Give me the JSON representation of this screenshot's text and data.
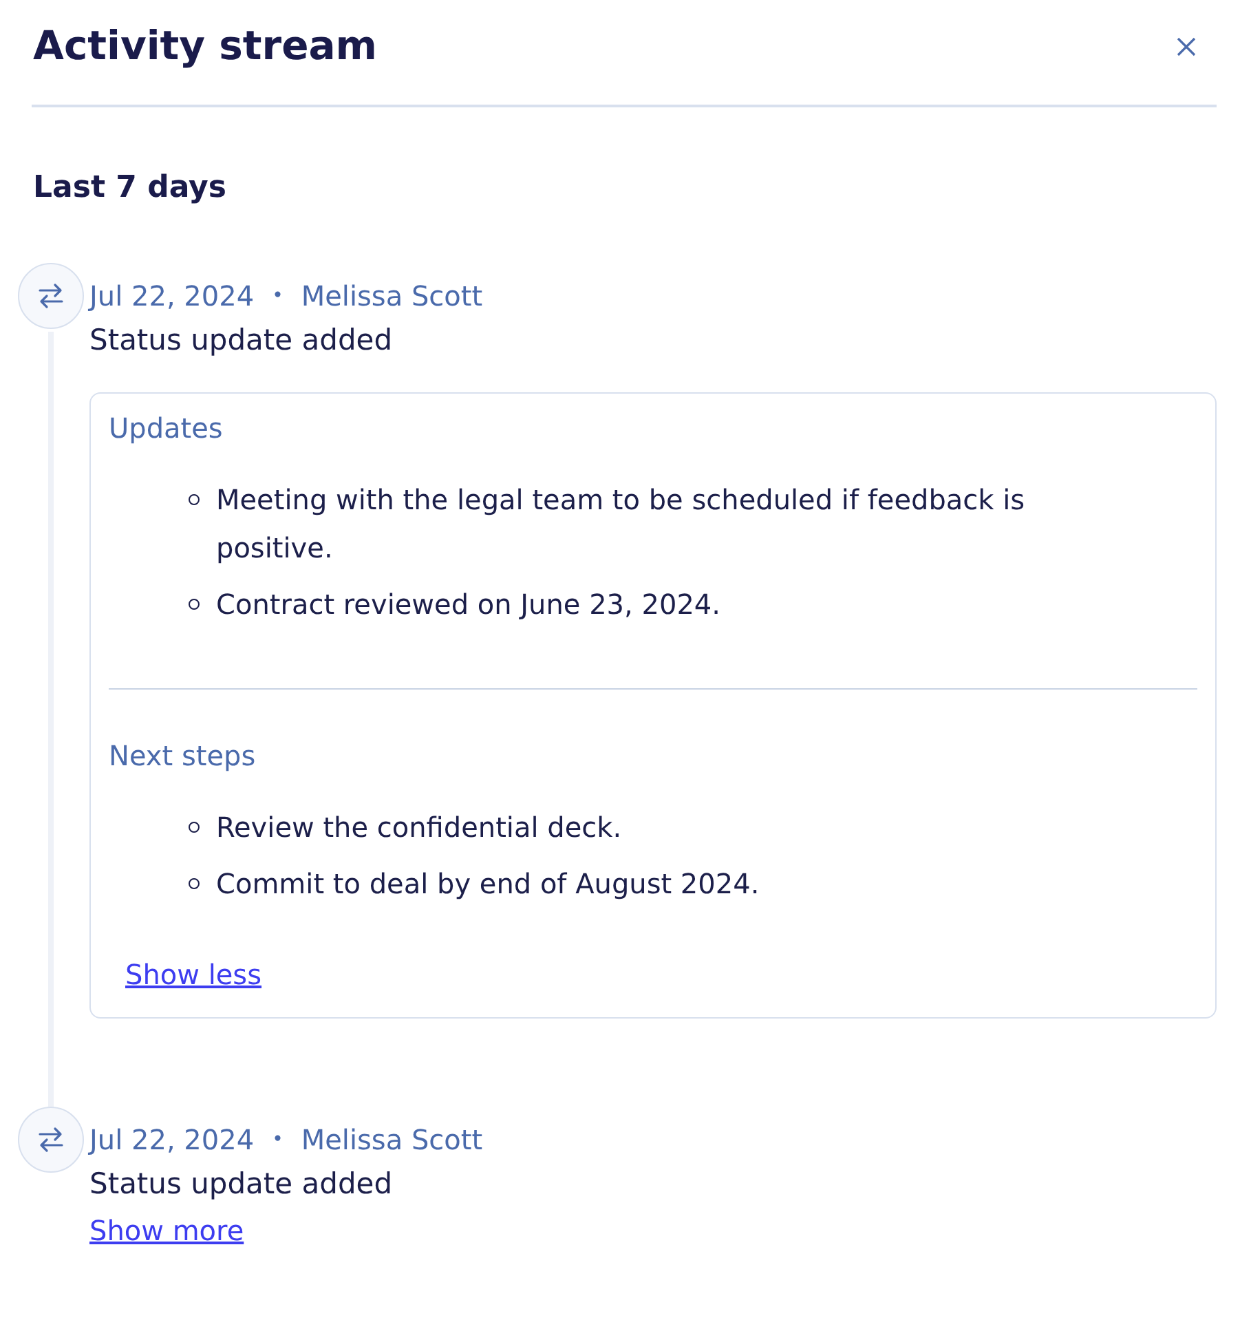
{
  "panel": {
    "title": "Activity stream"
  },
  "period": "Last 7 days",
  "entries": [
    {
      "date": "Jul 22, 2024",
      "separator": "•",
      "author": "Melissa Scott",
      "action": "Status update added",
      "expanded": true,
      "sections": [
        {
          "heading": "Updates",
          "items": [
            "Meeting with the legal team to be scheduled if feedback is positive.",
            "Contract reviewed on June 23, 2024."
          ]
        },
        {
          "heading": "Next steps",
          "items": [
            "Review the confidential deck.",
            "Commit to deal by end of August 2024."
          ]
        }
      ],
      "toggle_label": "Show less"
    },
    {
      "date": "Jul 22, 2024",
      "separator": "•",
      "author": "Melissa Scott",
      "action": "Status update added",
      "expanded": false,
      "toggle_label": "Show more"
    }
  ]
}
